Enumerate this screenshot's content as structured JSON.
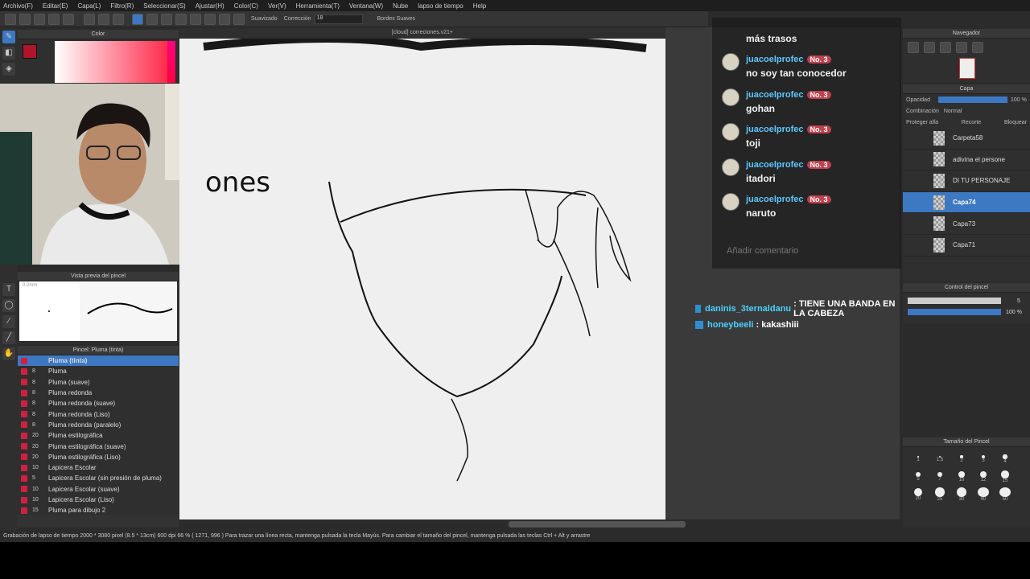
{
  "menubar": {
    "items": [
      "Archivo(F)",
      "Editar(E)",
      "Capa(L)",
      "Filtro(R)",
      "Seleccionar(S)",
      "Ajustar(H)",
      "Color(C)",
      "Ver(V)",
      "Herramienta(T)",
      "Ventana(W)",
      "Nube",
      "lapso de tiempo",
      "Help"
    ]
  },
  "toolbar": {
    "smoothing_label": "Suavizado",
    "correction_label": "Corrección",
    "correction_value": "18",
    "soft_edges_label": "Bordes Suaves"
  },
  "panels": {
    "color_title": "Color",
    "brush_preview_title": "Vista previa del pincel",
    "brush_preview_size": "0.2mm",
    "brush_list_title": "Pincel: Pluma (tinta)",
    "navigator_title": "Navegador",
    "layer_title": "Capa",
    "brush_control_title": "Control del pincel",
    "brush_size_title": "Tamaño del Pincel"
  },
  "brushes": [
    {
      "num": "",
      "name": "Pluma (tinta)",
      "selected": true
    },
    {
      "num": "8",
      "name": "Pluma"
    },
    {
      "num": "8",
      "name": "Pluma (suave)"
    },
    {
      "num": "8",
      "name": "Pluma redonda"
    },
    {
      "num": "8",
      "name": "Pluma redonda (suave)"
    },
    {
      "num": "8",
      "name": "Pluma redonda (Liso)"
    },
    {
      "num": "8",
      "name": "Pluma redonda (paralelo)"
    },
    {
      "num": "20",
      "name": "Pluma estilográfica"
    },
    {
      "num": "20",
      "name": "Pluma estilográfica (suave)"
    },
    {
      "num": "20",
      "name": "Pluma estilográfica (Liso)"
    },
    {
      "num": "10",
      "name": "Lapicera Escolar"
    },
    {
      "num": "5",
      "name": "Lapicera Escolar (sin presión de pluma)"
    },
    {
      "num": "10",
      "name": "Lapicera Escolar (suave)"
    },
    {
      "num": "10",
      "name": "Lapicera Escolar (Liso)"
    },
    {
      "num": "15",
      "name": "Pluma para dibujo 2"
    }
  ],
  "canvas": {
    "title": "[cloud] correciones.v21+",
    "word_fragment": "ones"
  },
  "chat": {
    "partial_top_text": "más trasos",
    "messages": [
      {
        "user": "juacoelprofec",
        "badge": "No. 3",
        "text": "no soy tan conocedor"
      },
      {
        "user": "juacoelprofec",
        "badge": "No. 3",
        "text": "gohan"
      },
      {
        "user": "juacoelprofec",
        "badge": "No. 3",
        "text": "toji"
      },
      {
        "user": "juacoelprofec",
        "badge": "No. 3",
        "text": "itadori"
      },
      {
        "user": "juacoelprofec",
        "badge": "No. 3",
        "text": "naruto"
      }
    ],
    "input_placeholder": "Añadir comentario"
  },
  "ticker": [
    {
      "user": "daninis_3ternaldanu",
      "text": ": TIENE UNA BANDA EN LA CABEZA"
    },
    {
      "user": "honeybeeli",
      "text": ": kakashiii"
    }
  ],
  "layers_panel": {
    "opacity_label": "Opacidad",
    "opacity_value": "100 %",
    "blend_label": "Combinación",
    "blend_value": "Normal",
    "protect_alpha": "Proteger alfa",
    "clip": "Recorte",
    "lock": "Bloquear",
    "layers": [
      {
        "name": "Carpeta58",
        "selected": false
      },
      {
        "name": "adivina el persone",
        "selected": false
      },
      {
        "name": "DI TU PERSONAJE",
        "selected": false
      },
      {
        "name": "Capa74",
        "selected": true
      },
      {
        "name": "Capa73",
        "selected": false
      },
      {
        "name": "Capa71",
        "selected": false
      }
    ]
  },
  "brush_control": {
    "size_value": "5",
    "opacity_value": "100 %"
  },
  "brush_sizes": [
    "1",
    "1.5",
    "2",
    "3",
    "4",
    "5",
    "7",
    "10",
    "12",
    "15",
    "20",
    "25",
    "30",
    "40",
    "50"
  ],
  "status": {
    "text": "Grabación de lapso de tiempo   2000 * 3080 pixel  (8.5 * 13cm)  600 dpi   66 %   ( 1271, 996 )   Para trazar una línea recta, mantenga pulsada la tecla Mayús. Para cambiar el tamaño del pincel, mantenga pulsada las teclas Ctrl + Alt y arrastre"
  },
  "colors": {
    "accent": "#3d78c2",
    "chat_user": "#5ec7ff",
    "badge": "#c0404e",
    "main_color": "#b0142a"
  }
}
